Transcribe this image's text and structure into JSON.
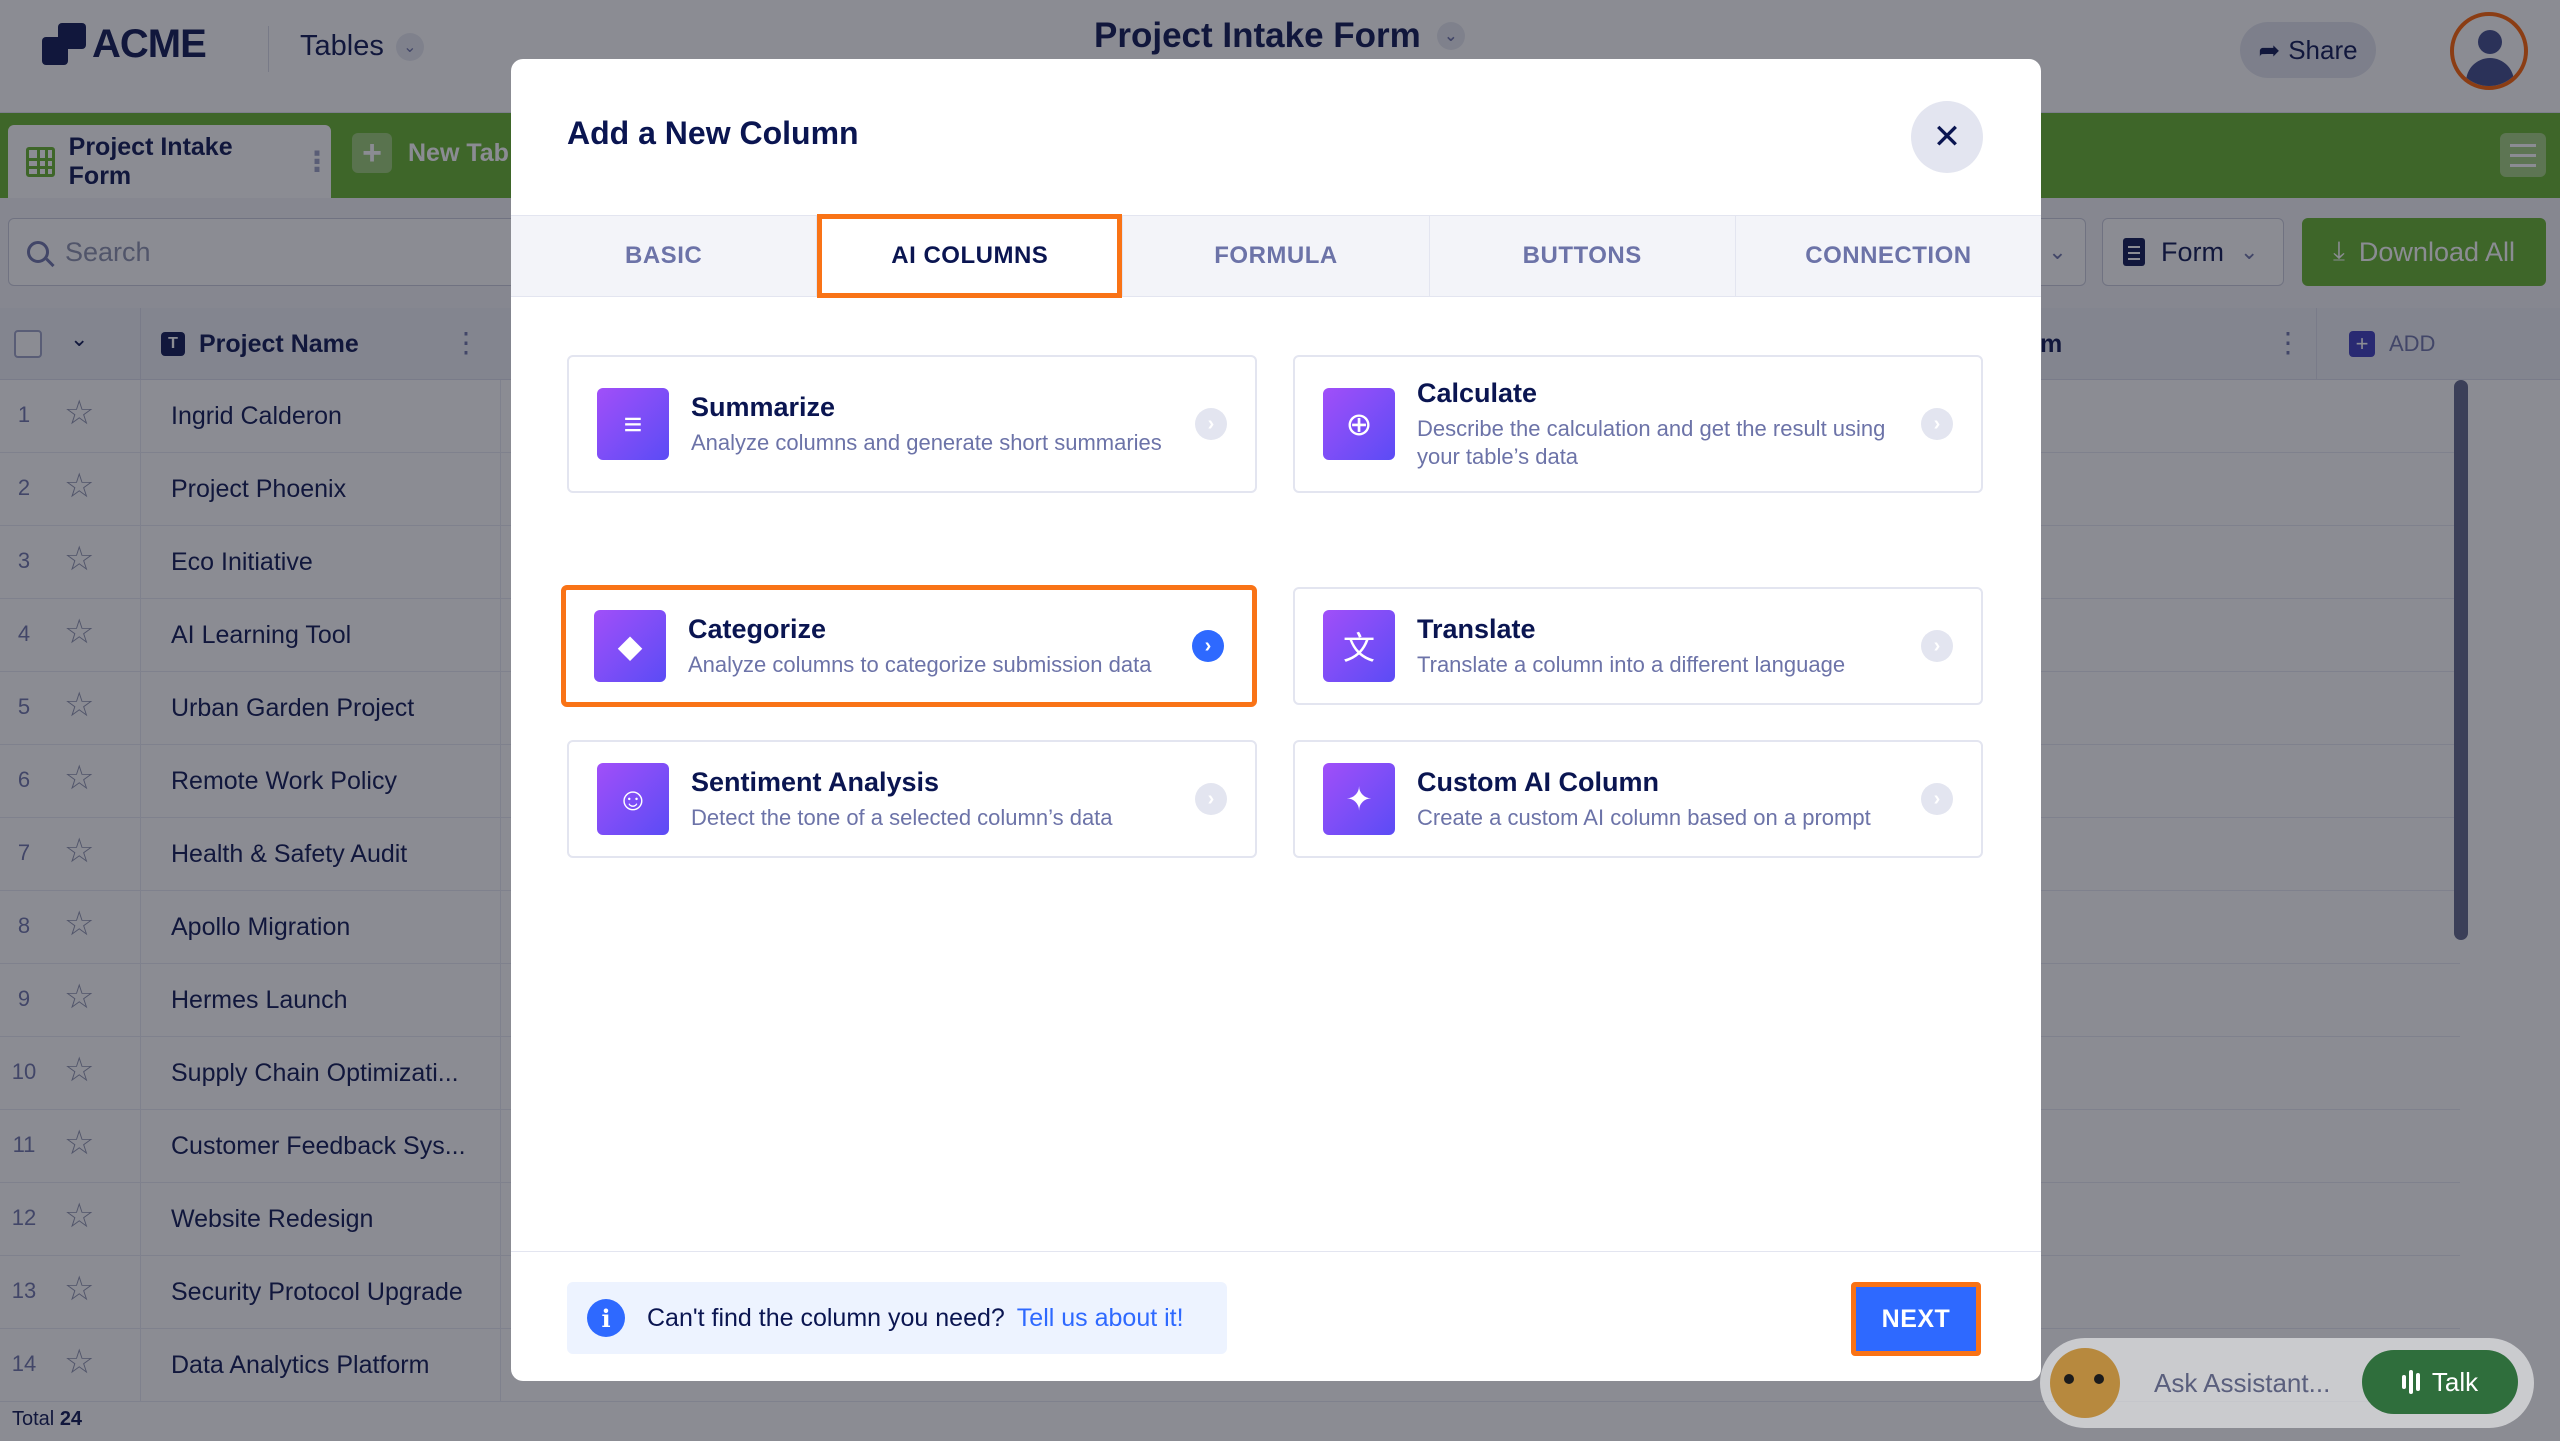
{
  "app": {
    "logo_text": "ACME",
    "tables_label": "Tables",
    "page_title": "Project Intake Form",
    "share_label": "Share"
  },
  "tabbar": {
    "active_tab": "Project Intake Form",
    "new_tab": "New Tab"
  },
  "toolbar": {
    "search_placeholder": "Search",
    "view_label": "Form",
    "download_label": "Download All"
  },
  "table": {
    "column_name": "Project Name",
    "column_right_partial": "m",
    "add_column": "ADD",
    "rows": [
      {
        "num": "1",
        "name": "Ingrid Calderon"
      },
      {
        "num": "2",
        "name": "Project Phoenix"
      },
      {
        "num": "3",
        "name": "Eco Initiative"
      },
      {
        "num": "4",
        "name": "AI Learning Tool"
      },
      {
        "num": "5",
        "name": "Urban Garden Project"
      },
      {
        "num": "6",
        "name": "Remote Work Policy"
      },
      {
        "num": "7",
        "name": "Health & Safety Audit"
      },
      {
        "num": "8",
        "name": "Apollo Migration"
      },
      {
        "num": "9",
        "name": "Hermes Launch"
      },
      {
        "num": "10",
        "name": "Supply Chain Optimizati..."
      },
      {
        "num": "11",
        "name": "Customer Feedback Sys..."
      },
      {
        "num": "12",
        "name": "Website Redesign"
      },
      {
        "num": "13",
        "name": "Security Protocol Upgrade"
      },
      {
        "num": "14",
        "name": "Data Analytics Platform"
      }
    ],
    "total_label": "Total",
    "total_value": "24"
  },
  "modal": {
    "title": "Add a New Column",
    "tabs": [
      "BASIC",
      "AI COLUMNS",
      "FORMULA",
      "BUTTONS",
      "CONNECTION"
    ],
    "active_tab": "AI COLUMNS",
    "cards": [
      {
        "title": "Summarize",
        "desc": "Analyze columns and generate short summaries",
        "icon": "summarize-icon"
      },
      {
        "title": "Calculate",
        "desc": "Describe the calculation and get the result using your table’s data",
        "icon": "calculate-icon"
      },
      {
        "title": "Categorize",
        "desc": "Analyze columns to categorize submission data",
        "icon": "categorize-icon"
      },
      {
        "title": "Translate",
        "desc": "Translate a column into a different language",
        "icon": "translate-icon"
      },
      {
        "title": "Sentiment Analysis",
        "desc": "Detect the tone of a selected column’s data",
        "icon": "sentiment-icon"
      },
      {
        "title": "Custom AI Column",
        "desc": "Create a custom AI column based on a prompt",
        "icon": "sparkle-icon"
      }
    ],
    "selected_card": "Categorize",
    "hint_text": "Can't find the column you need?",
    "hint_link": "Tell us about it!",
    "next_label": "NEXT"
  },
  "assistant": {
    "placeholder": "Ask Assistant...",
    "talk_label": "Talk"
  },
  "colors": {
    "brand_green": "#64b22a",
    "accent_blue": "#2e69ff",
    "highlight_orange": "#f97316",
    "navy_text": "#0a1551"
  }
}
